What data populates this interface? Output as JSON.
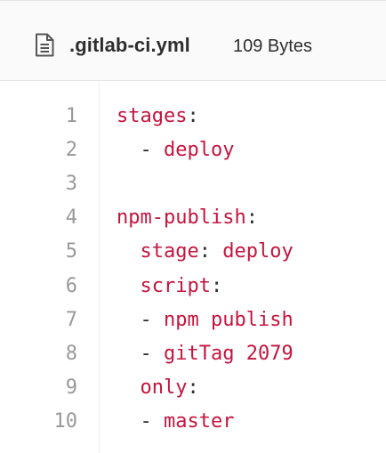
{
  "file": {
    "name": ".gitlab-ci.yml",
    "size": "109 Bytes",
    "icon": "file-text-icon"
  },
  "code": {
    "lines": [
      {
        "number": "1",
        "indent": "",
        "dash": "",
        "key": "stages",
        "colon": ":",
        "value": ""
      },
      {
        "number": "2",
        "indent": "  ",
        "dash": "- ",
        "key": "",
        "colon": "",
        "value": "deploy"
      },
      {
        "number": "3",
        "indent": "",
        "dash": "",
        "key": "",
        "colon": "",
        "value": ""
      },
      {
        "number": "4",
        "indent": "",
        "dash": "",
        "key": "npm-publish",
        "colon": ":",
        "value": ""
      },
      {
        "number": "5",
        "indent": "  ",
        "dash": "",
        "key": "stage",
        "colon": ": ",
        "value": "deploy"
      },
      {
        "number": "6",
        "indent": "  ",
        "dash": "",
        "key": "script",
        "colon": ":",
        "value": ""
      },
      {
        "number": "7",
        "indent": "  ",
        "dash": "- ",
        "key": "",
        "colon": "",
        "value": "npm publish"
      },
      {
        "number": "8",
        "indent": "  ",
        "dash": "- ",
        "key": "",
        "colon": "",
        "value": "gitTag 2079"
      },
      {
        "number": "9",
        "indent": "  ",
        "dash": "",
        "key": "only",
        "colon": ":",
        "value": ""
      },
      {
        "number": "10",
        "indent": "  ",
        "dash": "- ",
        "key": "",
        "colon": "",
        "value": "master"
      }
    ]
  },
  "colors": {
    "keyword": "#c4153d",
    "punctuation": "#2e2e2e",
    "line_number": "#999999",
    "header_bg": "#fafafa"
  }
}
